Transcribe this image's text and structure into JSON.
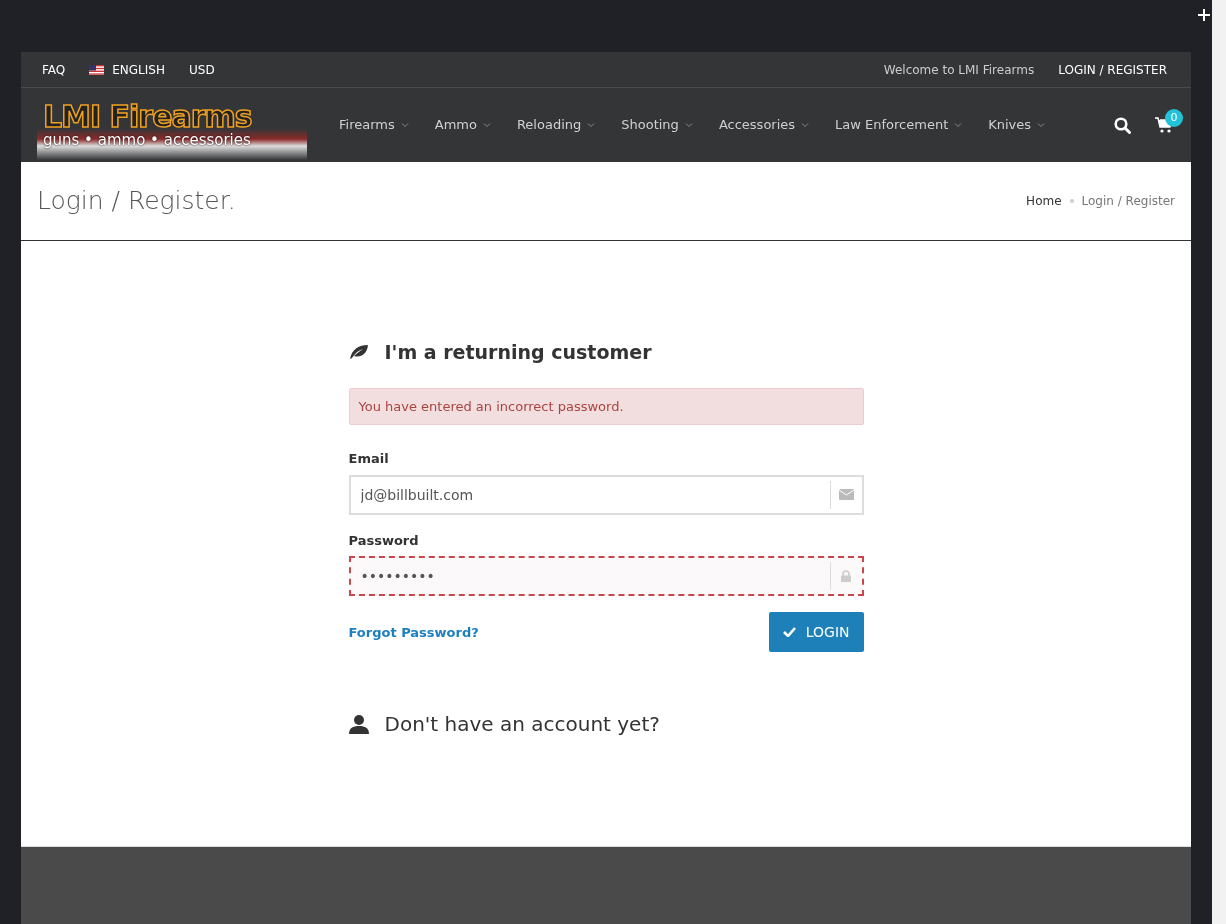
{
  "topbar": {
    "left": [
      {
        "kind": "link",
        "label": "FAQ"
      },
      {
        "kind": "language",
        "label": "ENGLISH"
      },
      {
        "kind": "link",
        "label": "USD"
      }
    ],
    "welcome": "Welcome to LMI Firearms",
    "account_link": "LOGIN / REGISTER"
  },
  "logo": {
    "name": "LMI Firearms",
    "tagline": "guns • ammo • accessories"
  },
  "nav": [
    {
      "label": "Firearms"
    },
    {
      "label": "Ammo"
    },
    {
      "label": "Reloading"
    },
    {
      "label": "Shooting"
    },
    {
      "label": "Accessories"
    },
    {
      "label": "Law Enforcement"
    },
    {
      "label": "Knives"
    }
  ],
  "cart": {
    "count": "0"
  },
  "page_title": "Login / Register.",
  "breadcrumb": [
    {
      "label": "Home",
      "current": false
    },
    {
      "label": "Login / Register",
      "current": true
    }
  ],
  "login": {
    "heading": "I'm a returning customer",
    "alert": {
      "kind": "danger",
      "text": "You have entered an incorrect password."
    },
    "fields": [
      {
        "label": "Email",
        "value": "jd@billbuilt.com",
        "kind": "email",
        "invalid": false
      },
      {
        "label": "Password",
        "value": "•••••••••",
        "kind": "password",
        "invalid": true
      }
    ],
    "forgot_link": "Forgot Password?",
    "submit": "LOGIN"
  },
  "register": {
    "heading": "Don't have an account yet?"
  }
}
